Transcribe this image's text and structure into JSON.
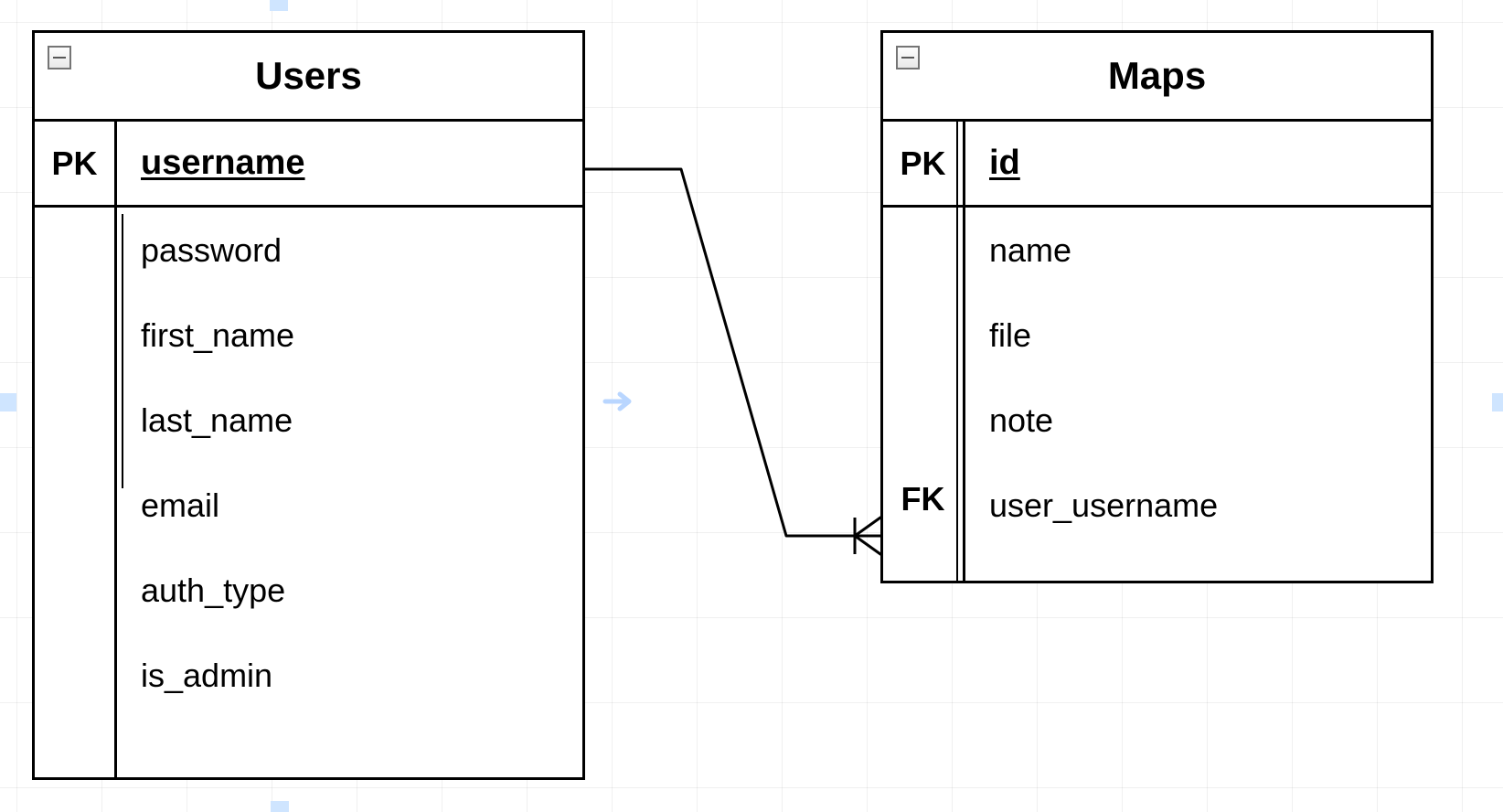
{
  "entities": {
    "users": {
      "title": "Users",
      "pk_label": "PK",
      "pk_attr": "username",
      "attrs": [
        "password",
        "first_name",
        "last_name",
        "email",
        "auth_type",
        "is_admin"
      ]
    },
    "maps": {
      "title": "Maps",
      "pk_label": "PK",
      "pk_attr": "id",
      "fk_label": "FK",
      "attrs": [
        "name",
        "file",
        "note",
        "user_username"
      ]
    }
  },
  "relationship": {
    "from_entity": "Users",
    "from_attr": "username",
    "to_entity": "Maps",
    "to_attr": "user_username",
    "cardinality": "one-to-many"
  }
}
